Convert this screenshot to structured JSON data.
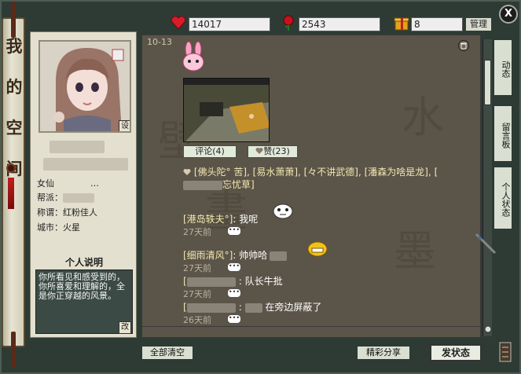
{
  "scroll_title": [
    "我",
    "的",
    "空",
    "间"
  ],
  "header": {
    "hearts": "14017",
    "roses": "2543",
    "gifts": "8",
    "manage_label": "管理",
    "close_label": "X"
  },
  "profile": {
    "gender_label": "女仙",
    "gender_suffix": "…",
    "gang_label": "帮派：",
    "title_label": "称谓：",
    "title_value": "红粉佳人",
    "city_label": "城市：",
    "city_value": "火星",
    "photo_button": "设",
    "desc_title": "个人说明",
    "desc_text": "你所看见和感受到的，你所喜爱和理解的，全是你正穿越的风景。",
    "desc_edit": "改"
  },
  "post": {
    "date": "10-13",
    "comment_btn": "评论(4)",
    "like_btn": "赞(23)",
    "likes_text": "[佛头陀° 苦], [易水萧萧], [々不讲武德], [潘森为啥是龙], [",
    "likes_tail": "忘忧草]"
  },
  "comments": [
    {
      "name": "[港岛轶夫°]",
      "sep": ":",
      "text": "我呢",
      "time": "27天前"
    },
    {
      "name": "[细雨清风°]",
      "sep": ":",
      "text": "帅帅哈",
      "time": "27天前"
    },
    {
      "name": "[",
      "sep": ":",
      "text": "队长牛批",
      "time": "27天前"
    },
    {
      "name": "[",
      "sep": ":",
      "text": "在旁边屏蔽了",
      "time": "26天前"
    }
  ],
  "tabs": [
    "动态",
    "留言板",
    "个人状态"
  ],
  "buttons": {
    "clear_all": "全部清空",
    "share": "精彩分享",
    "post_status": "发状态"
  },
  "colors": {
    "accent": "#f2e6ae",
    "panel": "#5b5448"
  }
}
